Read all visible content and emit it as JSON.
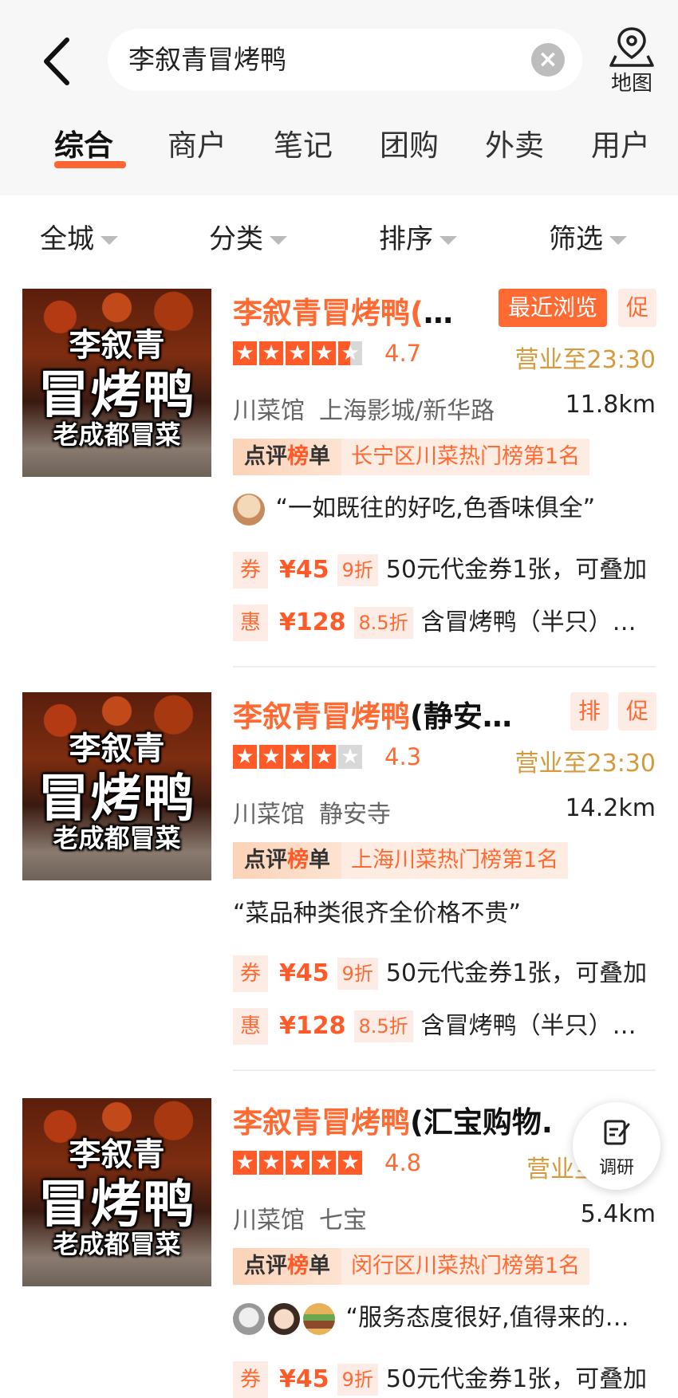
{
  "header": {
    "search_text": "李叙青冒烤鸭",
    "map_label": "地图"
  },
  "tabs": [
    "综合",
    "商户",
    "笔记",
    "团购",
    "外卖",
    "用户"
  ],
  "active_tab": 0,
  "filters": [
    "全城",
    "分类",
    "排序",
    "筛选"
  ],
  "results": [
    {
      "thumb": {
        "line1": "李叙青",
        "line2": "冒烤鸭",
        "line3": "老成都冒菜"
      },
      "title_highlight": "李叙青冒烤鸭(",
      "title_rest": "…",
      "tags": [
        "最近浏览",
        "促"
      ],
      "rating": "4.7",
      "stars": 4.5,
      "hours": "营业至23:30",
      "category": "川菜馆",
      "area": "上海影城/新华路",
      "distance": "11.8km",
      "rank_badge_1": "点评",
      "rank_badge_2": "榜",
      "rank_badge_3": "单",
      "rank_text": "长宁区川菜热门榜第1名",
      "review": "“一如既往的好吃,色香味俱全”",
      "deals": [
        {
          "label": "券",
          "price": "¥45",
          "discount": "9折",
          "desc": "50元代金券1张，可叠加"
        },
        {
          "label": "惠",
          "price": "¥128",
          "discount": "8.5折",
          "desc": "含冒烤鸭（半只）…"
        }
      ]
    },
    {
      "thumb": {
        "line1": "李叙青",
        "line2": "冒烤鸭",
        "line3": "老成都冒菜"
      },
      "title_highlight": "李叙青冒烤鸭",
      "title_rest": "(静安…",
      "tags": [
        "排",
        "促"
      ],
      "rating": "4.3",
      "stars": 4,
      "hours": "营业至23:30",
      "category": "川菜馆",
      "area": "静安寺",
      "distance": "14.2km",
      "rank_badge_1": "点评",
      "rank_badge_2": "榜",
      "rank_badge_3": "单",
      "rank_text": "上海川菜热门榜第1名",
      "review": "“菜品种类很齐全价格不贵”",
      "deals": [
        {
          "label": "券",
          "price": "¥45",
          "discount": "9折",
          "desc": "50元代金券1张，可叠加"
        },
        {
          "label": "惠",
          "price": "¥128",
          "discount": "8.5折",
          "desc": "含冒烤鸭（半只）…"
        }
      ]
    },
    {
      "thumb": {
        "line1": "李叙青",
        "line2": "冒烤鸭",
        "line3": "老成都冒菜"
      },
      "title_highlight": "李叙青冒烤鸭",
      "title_rest": "(汇宝购物.",
      "tags": [],
      "rating": "4.8",
      "stars": 5,
      "hours": "营业至",
      "category": "川菜馆",
      "area": "七宝",
      "distance": "5.4km",
      "rank_badge_1": "点评",
      "rank_badge_2": "榜",
      "rank_badge_3": "单",
      "rank_text": "闵行区川菜热门榜第1名",
      "review": "“服务态度很好,值得来的…",
      "deals": [
        {
          "label": "券",
          "price": "¥45",
          "discount": "9折",
          "desc": "50元代金券1张，可叠加"
        }
      ]
    }
  ],
  "survey_label": "调研",
  "colors": {
    "accent": "#ff6a33",
    "hours": "#d49a3c",
    "tag_bg": "#fdece5"
  }
}
